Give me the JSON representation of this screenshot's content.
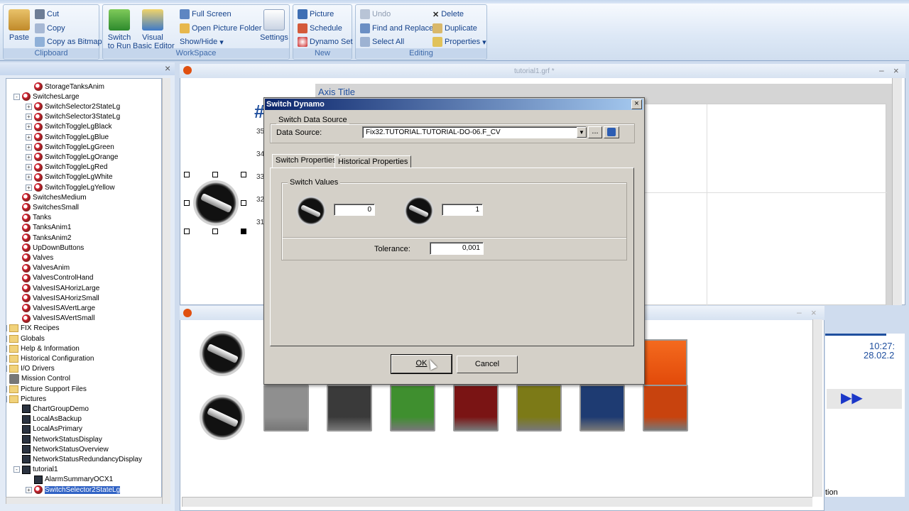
{
  "ribbon": {
    "clipboard": {
      "label": "Clipboard",
      "paste": "Paste",
      "cut": "Cut",
      "copy": "Copy",
      "copy_bitmap": "Copy as Bitmap"
    },
    "workspace": {
      "label": "WorkSpace",
      "switch_run": "Switch\nto Run",
      "vb_editor": "Visual\nBasic Editor",
      "full_screen": "Full Screen",
      "open_folder": "Open Picture Folder",
      "show_hide": "Show/Hide",
      "settings": "Settings"
    },
    "new": {
      "label": "New",
      "picture": "Picture",
      "schedule": "Schedule",
      "dynamo_set": "Dynamo Set"
    },
    "editing": {
      "label": "Editing",
      "undo": "Undo",
      "find_replace": "Find and Replace",
      "select_all": "Select All",
      "delete": "Delete",
      "duplicate": "Duplicate",
      "properties": "Properties"
    }
  },
  "tree": {
    "close": "×",
    "items": [
      {
        "label": "StorageTanksAnim",
        "level": 3,
        "icon": "dynamo"
      },
      {
        "label": "SwitchesLarge",
        "level": 2,
        "icon": "dynamo",
        "expander": "-"
      },
      {
        "label": "SwitchSelector2StateLg",
        "level": 3,
        "icon": "dynamo",
        "expander": "+"
      },
      {
        "label": "SwitchSelector3StateLg",
        "level": 3,
        "icon": "dynamo",
        "expander": "+"
      },
      {
        "label": "SwitchToggleLgBlack",
        "level": 3,
        "icon": "dynamo",
        "expander": "+"
      },
      {
        "label": "SwitchToggleLgBlue",
        "level": 3,
        "icon": "dynamo",
        "expander": "+"
      },
      {
        "label": "SwitchToggleLgGreen",
        "level": 3,
        "icon": "dynamo",
        "expander": "+"
      },
      {
        "label": "SwitchToggleLgOrange",
        "level": 3,
        "icon": "dynamo",
        "expander": "+"
      },
      {
        "label": "SwitchToggleLgRed",
        "level": 3,
        "icon": "dynamo",
        "expander": "+"
      },
      {
        "label": "SwitchToggleLgWhite",
        "level": 3,
        "icon": "dynamo",
        "expander": "+"
      },
      {
        "label": "SwitchToggleLgYellow",
        "level": 3,
        "icon": "dynamo",
        "expander": "+"
      },
      {
        "label": "SwitchesMedium",
        "level": 2,
        "icon": "dynamo"
      },
      {
        "label": "SwitchesSmall",
        "level": 2,
        "icon": "dynamo"
      },
      {
        "label": "Tanks",
        "level": 2,
        "icon": "dynamo"
      },
      {
        "label": "TanksAnim1",
        "level": 2,
        "icon": "dynamo"
      },
      {
        "label": "TanksAnim2",
        "level": 2,
        "icon": "dynamo"
      },
      {
        "label": "UpDownButtons",
        "level": 2,
        "icon": "dynamo"
      },
      {
        "label": "Valves",
        "level": 2,
        "icon": "dynamo"
      },
      {
        "label": "ValvesAnim",
        "level": 2,
        "icon": "dynamo"
      },
      {
        "label": "ValvesControlHand",
        "level": 2,
        "icon": "dynamo"
      },
      {
        "label": "ValvesISAHorizLarge",
        "level": 2,
        "icon": "dynamo"
      },
      {
        "label": "ValvesISAHorizSmall",
        "level": 2,
        "icon": "dynamo"
      },
      {
        "label": "ValvesISAVertLarge",
        "level": 2,
        "icon": "dynamo"
      },
      {
        "label": "ValvesISAVertSmall",
        "level": 2,
        "icon": "dynamo"
      },
      {
        "label": "FIX Recipes",
        "level": 1,
        "icon": "folder",
        "expander": "+"
      },
      {
        "label": "Globals",
        "level": 1,
        "icon": "folder",
        "expander": "+"
      },
      {
        "label": "Help & Information",
        "level": 1,
        "icon": "folder",
        "expander": "+"
      },
      {
        "label": "Historical Configuration",
        "level": 1,
        "icon": "folder",
        "expander": "+"
      },
      {
        "label": "I/O Drivers",
        "level": 1,
        "icon": "folder",
        "expander": "+"
      },
      {
        "label": "Mission Control",
        "level": 1,
        "icon": "tool"
      },
      {
        "label": "Picture Support Files",
        "level": 1,
        "icon": "folder",
        "expander": "+"
      },
      {
        "label": "Pictures",
        "level": 1,
        "icon": "folder",
        "expander": "-"
      },
      {
        "label": "ChartGroupDemo",
        "level": 2,
        "icon": "picture"
      },
      {
        "label": "LocalAsBackup",
        "level": 2,
        "icon": "picture"
      },
      {
        "label": "LocalAsPrimary",
        "level": 2,
        "icon": "picture"
      },
      {
        "label": "NetworkStatusDisplay",
        "level": 2,
        "icon": "picture"
      },
      {
        "label": "NetworkStatusOverview",
        "level": 2,
        "icon": "picture"
      },
      {
        "label": "NetworkStatusRedundancyDisplay",
        "level": 2,
        "icon": "picture"
      },
      {
        "label": "tutorial1",
        "level": 2,
        "icon": "picture",
        "expander": "-"
      },
      {
        "label": "AlarmSummaryOCX1",
        "level": 3,
        "icon": "picture"
      },
      {
        "label": "SwitchSelector2StateLg",
        "level": 3,
        "icon": "dynamo",
        "expander": "+",
        "selected": true
      }
    ]
  },
  "canvas": {
    "window_title": "tutorial1.grf *",
    "axis_title": "Axis Title",
    "hash": "#",
    "y_ticks": [
      "35",
      "34",
      "33",
      "32",
      "31"
    ],
    "clock_time": "10:27:",
    "clock_date": "28.02.2",
    "partial_label": "tion",
    "minimize": "–",
    "close": "×"
  },
  "dialog": {
    "title": "Switch Dynamo",
    "close": "×",
    "data_source_group": "Switch Data Source",
    "data_source_label": "Data Source:",
    "data_source_value": "Fix32.TUTORIAL.TUTORIAL-DO-06.F_CV",
    "browse": "...",
    "tabs": [
      "Switch Properties",
      "Historical Properties"
    ],
    "switch_values_group": "Switch Values",
    "value_off": "0",
    "value_on": "1",
    "tolerance_label": "Tolerance:",
    "tolerance_value": "0,001",
    "ok": "OK",
    "cancel": "Cancel"
  },
  "colors": {
    "ribbon_text": "#15428b",
    "dialog_title": "#0a246a",
    "selection": "#3163c5",
    "switch_colors": [
      "#8f8f8f",
      "#3a3a3a",
      "#3f8f2f",
      "#7a1414",
      "#7c7a17",
      "#1e3b72",
      "#c8430e"
    ]
  }
}
